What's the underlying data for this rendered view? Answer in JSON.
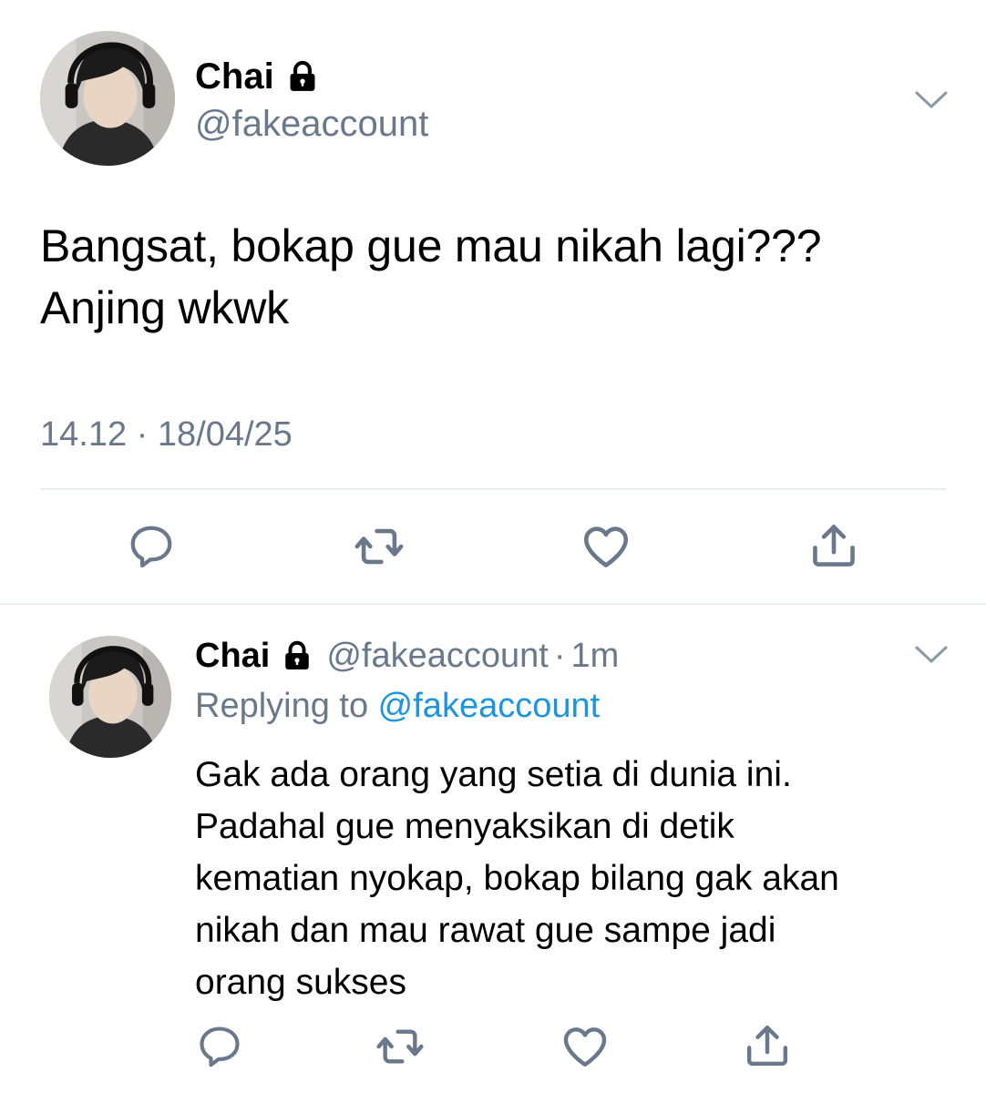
{
  "main_tweet": {
    "display_name": "Chai",
    "handle": "@fakeaccount",
    "text_lines": [
      "Bangsat, bokap gue mau nikah lagi???",
      "Anjing wkwk"
    ],
    "timestamp": "14.12 · 18/04/25",
    "actions": [
      "reply-icon",
      "retweet-icon",
      "like-icon",
      "share-icon"
    ]
  },
  "reply_tweet": {
    "display_name": "Chai",
    "handle": "@fakeaccount",
    "separator": "·",
    "time": "1m",
    "replying_prefix": "Replying to ",
    "replying_to": "@fakeaccount",
    "text_lines": [
      "Gak ada orang yang setia di dunia ini.",
      "Padahal gue menyaksikan di detik",
      "kematian nyokap, bokap bilang gak akan",
      "nikah dan mau rawat gue sampe jadi",
      "orang sukses"
    ],
    "actions": [
      "reply-icon",
      "retweet-icon",
      "like-icon",
      "share-icon"
    ]
  },
  "colors": {
    "secondary_text": "#69788a",
    "link": "#1b95e0",
    "icon": "#69788a",
    "divider": "#e6ecf0"
  }
}
